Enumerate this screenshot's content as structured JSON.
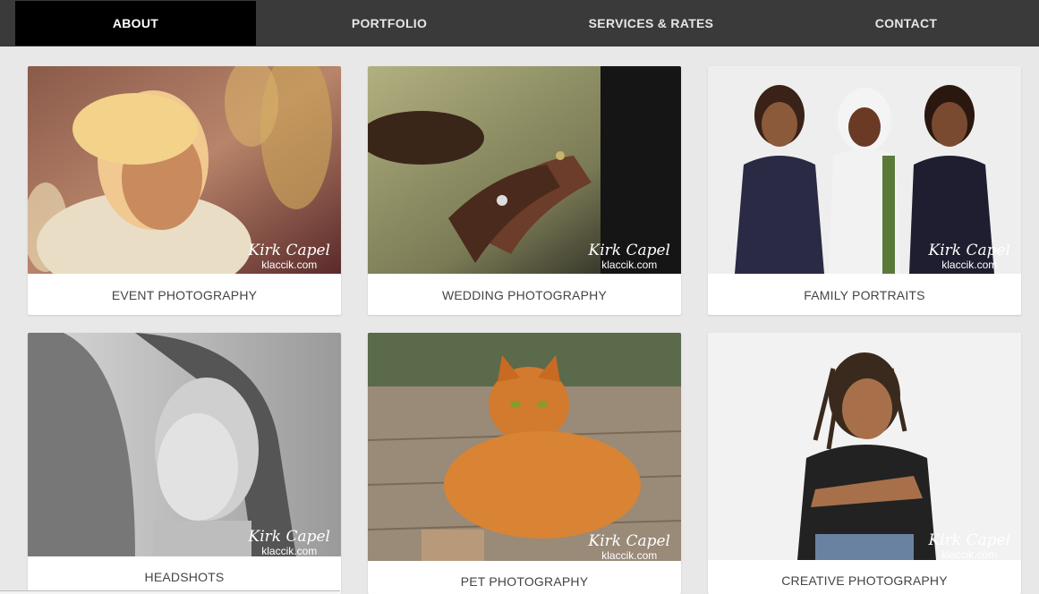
{
  "nav": {
    "items": [
      {
        "label": "ABOUT"
      },
      {
        "label": "PORTFOLIO"
      },
      {
        "label": "SERVICES & RATES"
      },
      {
        "label": "CONTACT"
      }
    ]
  },
  "watermark": {
    "signature": "Kirk Capel",
    "site": "klaccik.com"
  },
  "cards": [
    {
      "caption": "EVENT PHOTOGRAPHY"
    },
    {
      "caption": "WEDDING PHOTOGRAPHY"
    },
    {
      "caption": "FAMILY PORTRAITS"
    },
    {
      "caption": "HEADSHOTS"
    },
    {
      "caption": "PET PHOTOGRAPHY"
    },
    {
      "caption": "CREATIVE PHOTOGRAPHY"
    }
  ],
  "colors": {
    "nav_bg": "#3a3a3a",
    "nav_active": "#000000",
    "page_bg": "#e8e8e8"
  }
}
